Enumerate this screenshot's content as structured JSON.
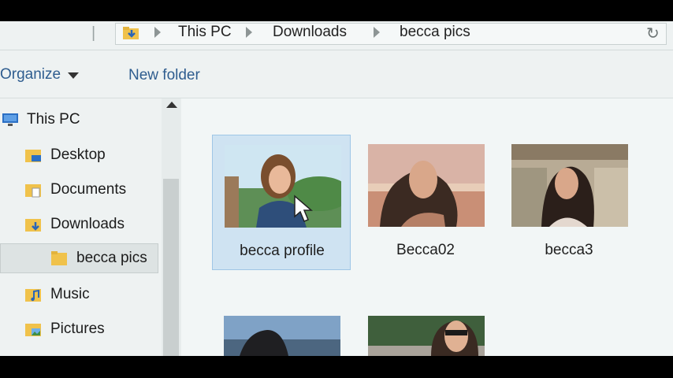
{
  "breadcrumb": {
    "items": [
      "This PC",
      "Downloads",
      "becca pics"
    ]
  },
  "toolbar": {
    "organize_label": "Organize",
    "new_folder_label": "New folder"
  },
  "nav": {
    "root_label": "This PC",
    "items": [
      {
        "label": "Desktop",
        "icon": "desktop-folder-icon"
      },
      {
        "label": "Documents",
        "icon": "documents-folder-icon"
      },
      {
        "label": "Downloads",
        "icon": "downloads-folder-icon"
      },
      {
        "label": "becca pics",
        "icon": "folder-icon",
        "selected": true
      },
      {
        "label": "Music",
        "icon": "music-folder-icon"
      },
      {
        "label": "Pictures",
        "icon": "pictures-folder-icon"
      }
    ]
  },
  "files": [
    {
      "label": "becca profile",
      "selected": true
    },
    {
      "label": "Becca02"
    },
    {
      "label": "becca3"
    },
    {
      "label": ""
    },
    {
      "label": ""
    }
  ],
  "colors": {
    "selection": "#cfe3f2",
    "link": "#2f5d8f",
    "folder": "#f0c24b"
  }
}
